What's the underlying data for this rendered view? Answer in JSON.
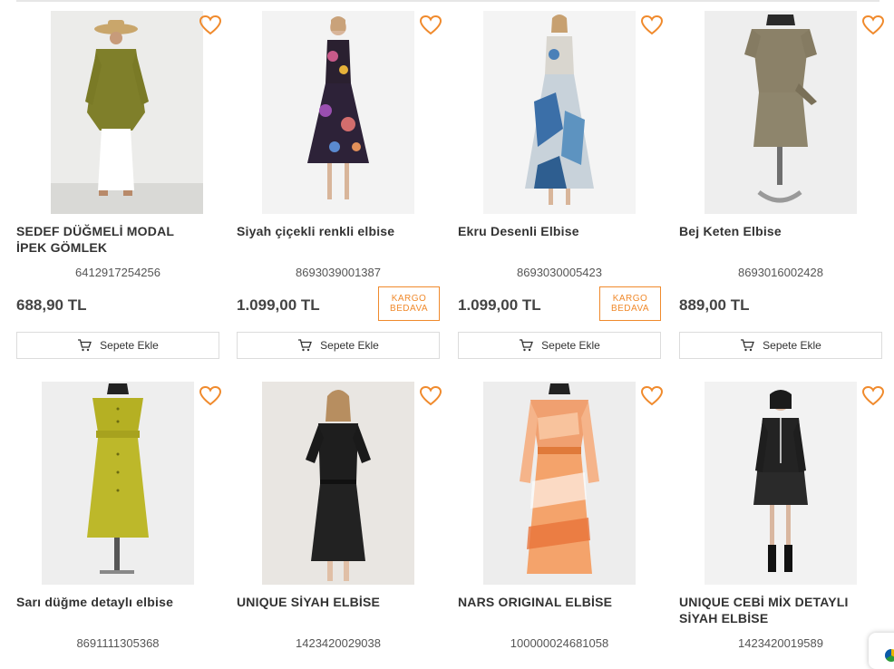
{
  "currency_colors": {
    "accent": "#f08a2c",
    "price": "#444444",
    "border": "#dcdcdc"
  },
  "products": [
    {
      "title": "SEDEF DÜĞMELİ MODAL İPEK GÖMLEK",
      "barcode": "6412917254256",
      "price": "688,90 TL",
      "badge": "",
      "cart_label": "Sepete Ekle",
      "favorite_icon": "heart-outline-icon",
      "image": "khaki-shirt-model"
    },
    {
      "title": "Siyah çiçekli renkli elbise",
      "barcode": "8693039001387",
      "price": "1.099,00 TL",
      "badge": "KARGO BEDAVA",
      "badge_line1": "KARGO",
      "badge_line2": "BEDAVA",
      "cart_label": "Sepete Ekle",
      "favorite_icon": "heart-outline-icon",
      "image": "floral-dress-model"
    },
    {
      "title": "Ekru Desenli Elbise",
      "barcode": "8693030005423",
      "price": "1.099,00 TL",
      "badge": "KARGO BEDAVA",
      "badge_line1": "KARGO",
      "badge_line2": "BEDAVA",
      "cart_label": "Sepete Ekle",
      "favorite_icon": "heart-outline-icon",
      "image": "ecru-pattern-dress-model"
    },
    {
      "title": "Bej Keten Elbise",
      "barcode": "8693016002428",
      "price": "889,00 TL",
      "badge": "",
      "cart_label": "Sepete Ekle",
      "favorite_icon": "heart-outline-icon",
      "image": "beige-linen-dress-mannequin"
    },
    {
      "title": "Sarı düğme detaylı elbise",
      "barcode": "8691111305368",
      "favorite_icon": "heart-outline-icon",
      "image": "yellow-dress-mannequin"
    },
    {
      "title": "UNIQUE SİYAH ELBİSE",
      "barcode": "1423420029038",
      "favorite_icon": "heart-outline-icon",
      "image": "black-dress-model"
    },
    {
      "title": "NARS ORIGINAL ELBİSE",
      "barcode": "100000024681058",
      "favorite_icon": "heart-outline-icon",
      "image": "orange-pattern-dress-mannequin"
    },
    {
      "title": "UNIQUE CEBİ MİX DETAYLI SİYAH ELBİSE",
      "barcode": "1423420019589",
      "favorite_icon": "heart-outline-icon",
      "image": "black-jacket-dress-model"
    }
  ]
}
